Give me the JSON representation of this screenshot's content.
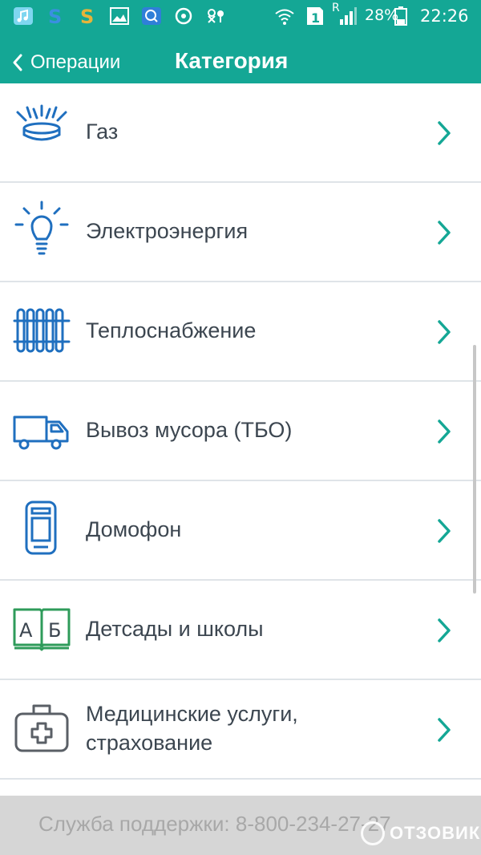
{
  "status_bar": {
    "battery": "28%",
    "time": "22:26",
    "sim_label": "1",
    "roaming_label": "R"
  },
  "nav": {
    "back_label": "Операции",
    "title": "Категория"
  },
  "colors": {
    "accent": "#14a795",
    "icon_blue": "#1f6fbf",
    "icon_green": "#2e9b5a",
    "icon_gray": "#5a5f66",
    "chevron": "#14a795"
  },
  "categories": [
    {
      "label": "Газ",
      "icon": "gas-burner-icon"
    },
    {
      "label": "Электроэнергия",
      "icon": "light-bulb-icon"
    },
    {
      "label": "Теплоснабжение",
      "icon": "radiator-icon"
    },
    {
      "label": "Вывоз мусора (ТБО)",
      "icon": "truck-icon"
    },
    {
      "label": "Домофон",
      "icon": "intercom-icon"
    },
    {
      "label": "Детсады и школы",
      "icon": "book-icon",
      "book_letters": [
        "А",
        "Б"
      ]
    },
    {
      "label_line1": "Медицинские услуги,",
      "label_line2": "страхование",
      "icon": "first-aid-kit-icon"
    }
  ],
  "footer": {
    "support_text": "Служба поддержки: 8-800-234-27-27"
  },
  "watermark": {
    "text": "ОТЗОВИК"
  }
}
